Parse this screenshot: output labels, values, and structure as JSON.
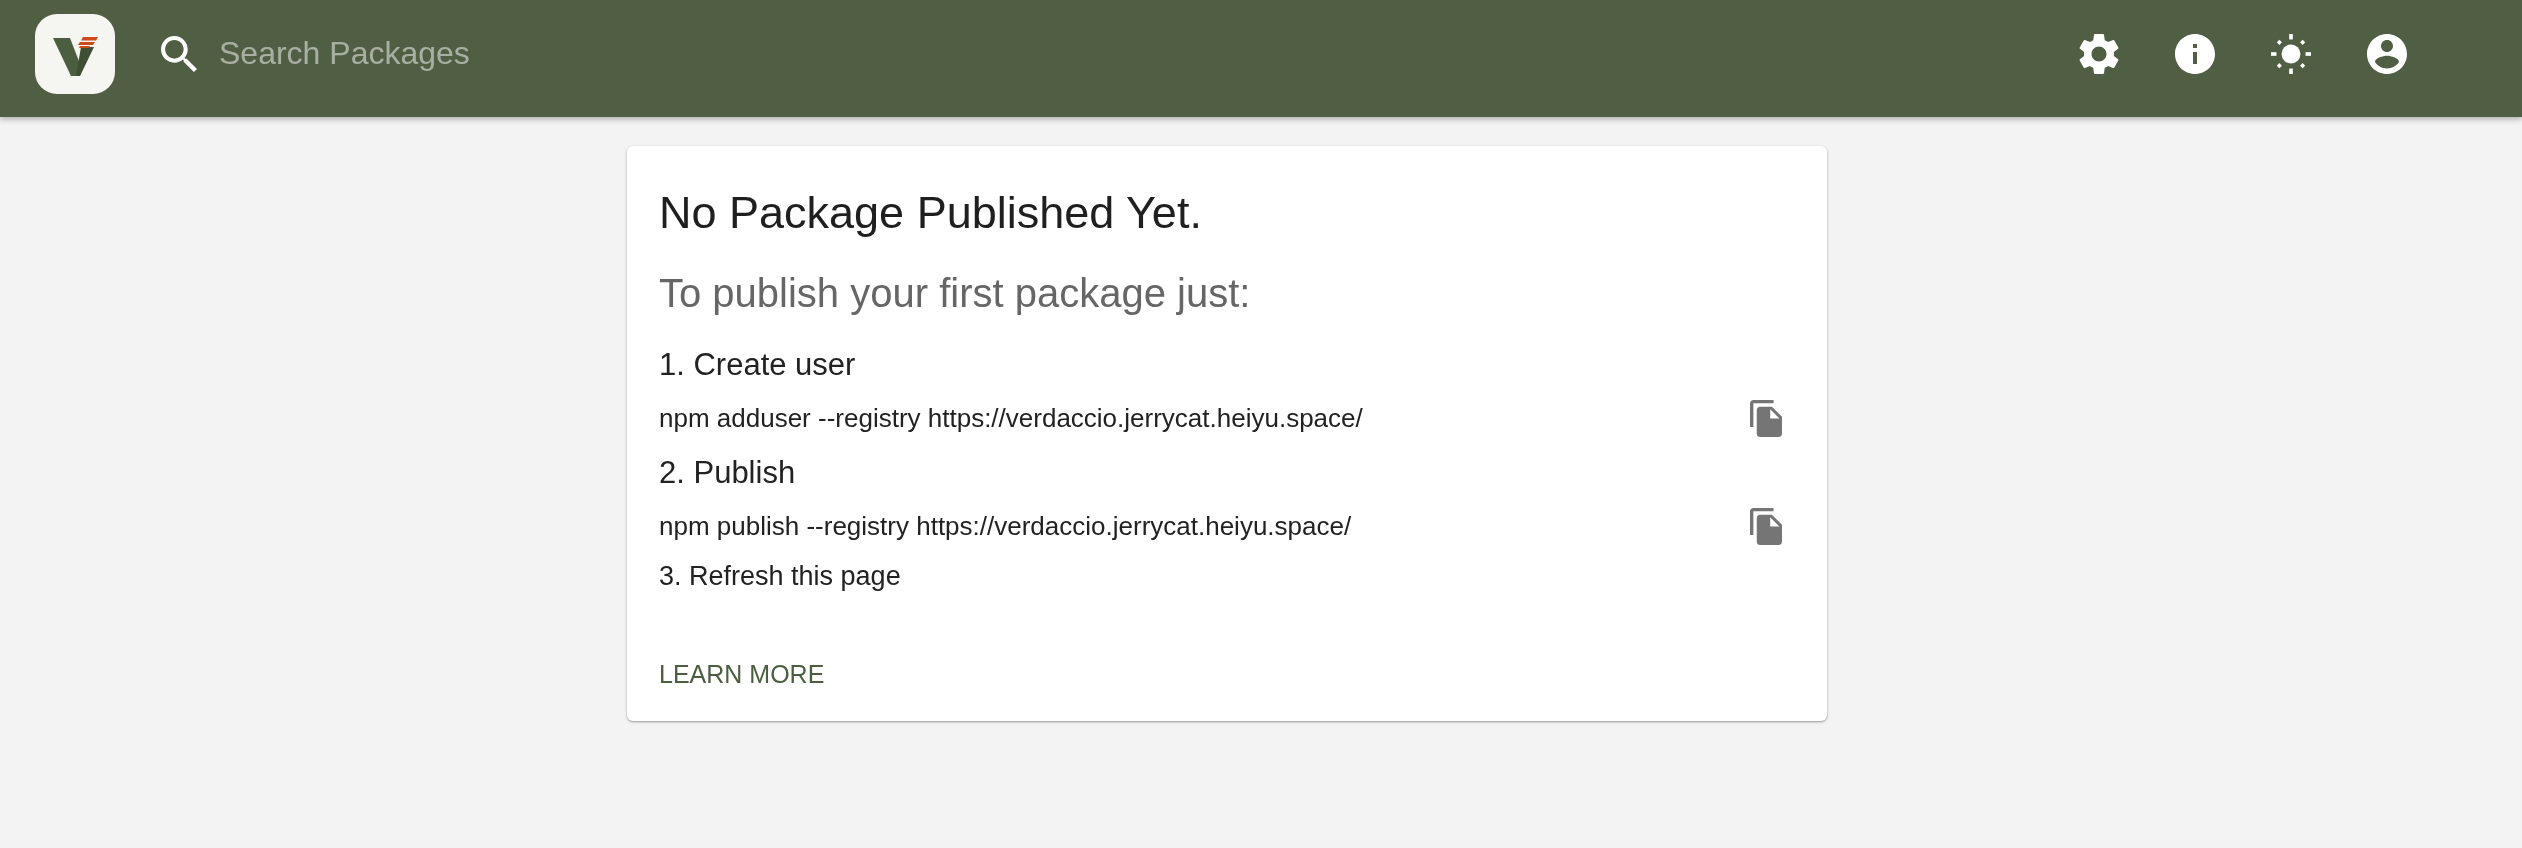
{
  "header": {
    "search": {
      "placeholder": "Search Packages"
    }
  },
  "card": {
    "title": "No Package Published Yet.",
    "subtitle": "To publish your first package just:",
    "steps": [
      {
        "label": "1. Create user",
        "command": "npm adduser --registry https://verdaccio.jerrycat.heiyu.space/"
      },
      {
        "label": "2. Publish",
        "command": "npm publish --registry https://verdaccio.jerrycat.heiyu.space/"
      }
    ],
    "final_step": "3. Refresh this page",
    "link": "LEARN MORE"
  }
}
